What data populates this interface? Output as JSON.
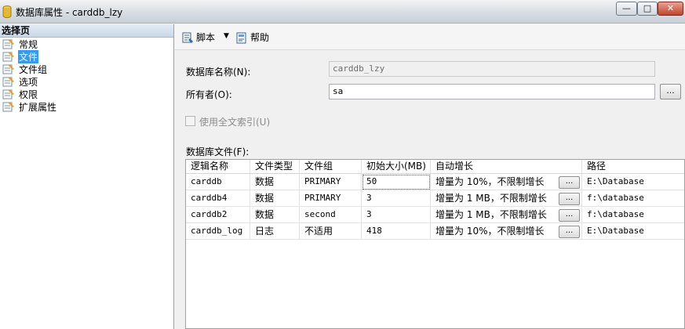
{
  "window": {
    "title": "数据库属性 - carddb_lzy",
    "minimize": "—",
    "maximize": "□",
    "close": "✕"
  },
  "left_pane": {
    "header": "选择页",
    "pages": [
      {
        "label": "常规",
        "selected": false
      },
      {
        "label": "文件",
        "selected": true
      },
      {
        "label": "文件组",
        "selected": false
      },
      {
        "label": "选项",
        "selected": false
      },
      {
        "label": "权限",
        "selected": false
      },
      {
        "label": "扩展属性",
        "selected": false
      }
    ]
  },
  "toolbar": {
    "script_label": "脚本",
    "dropdown_arrow": "▼",
    "help_label": "帮助"
  },
  "form": {
    "db_name_label": "数据库名称(N):",
    "db_name_value": "carddb_lzy",
    "owner_label": "所有者(O):",
    "owner_value": "sa",
    "owner_browse": "...",
    "fulltext_label": "使用全文索引(U)",
    "fulltext_checked": false,
    "db_files_label": "数据库文件(F):"
  },
  "grid": {
    "columns": [
      "逻辑名称",
      "文件类型",
      "文件组",
      "初始大小(MB)",
      "自动增长",
      "路径"
    ],
    "button_label": "...",
    "rows": [
      {
        "logical": "carddb",
        "type": "数据",
        "filegroup": "PRIMARY",
        "size": "50",
        "growth": "增量为 10%，不限制增长",
        "path": "E:\\Database"
      },
      {
        "logical": "carddb4",
        "type": "数据",
        "filegroup": "PRIMARY",
        "size": "3",
        "growth": "增量为 1 MB，不限制增长",
        "path": "f:\\database"
      },
      {
        "logical": "carddb2",
        "type": "数据",
        "filegroup": "second",
        "size": "3",
        "growth": "增量为 1 MB，不限制增长",
        "path": "f:\\database"
      },
      {
        "logical": "carddb_log",
        "type": "日志",
        "filegroup": "不适用",
        "size": "418",
        "growth": "增量为 10%，不限制增长",
        "path": "E:\\Database"
      }
    ]
  },
  "colors": {
    "selection": "#3399ff",
    "pane_header": "#c9d7e6"
  }
}
